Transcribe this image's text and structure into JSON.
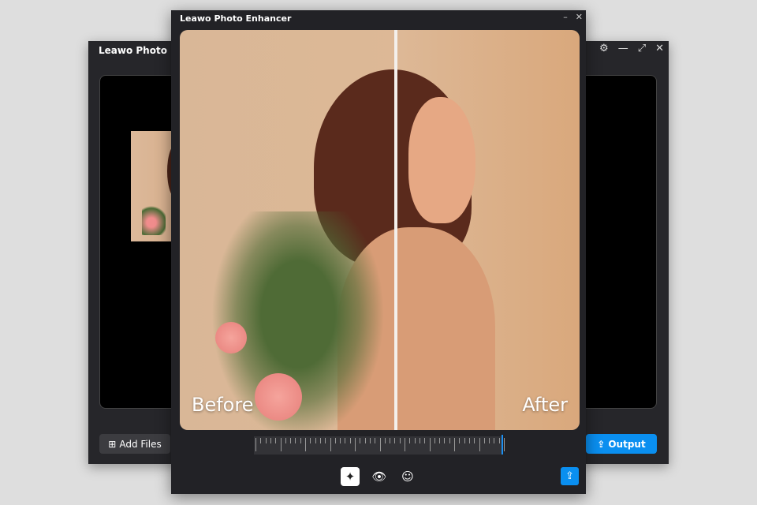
{
  "back_window": {
    "title": "Leawo Photo Enhancer",
    "add_files_label": "Add Files",
    "output_label": "Output"
  },
  "front_window": {
    "title": "Leawo Photo Enhancer",
    "before_label": "Before",
    "after_label": "After"
  },
  "zoom_slider": {
    "value_percent": 100
  },
  "colors": {
    "accent": "#0a8ff0"
  }
}
